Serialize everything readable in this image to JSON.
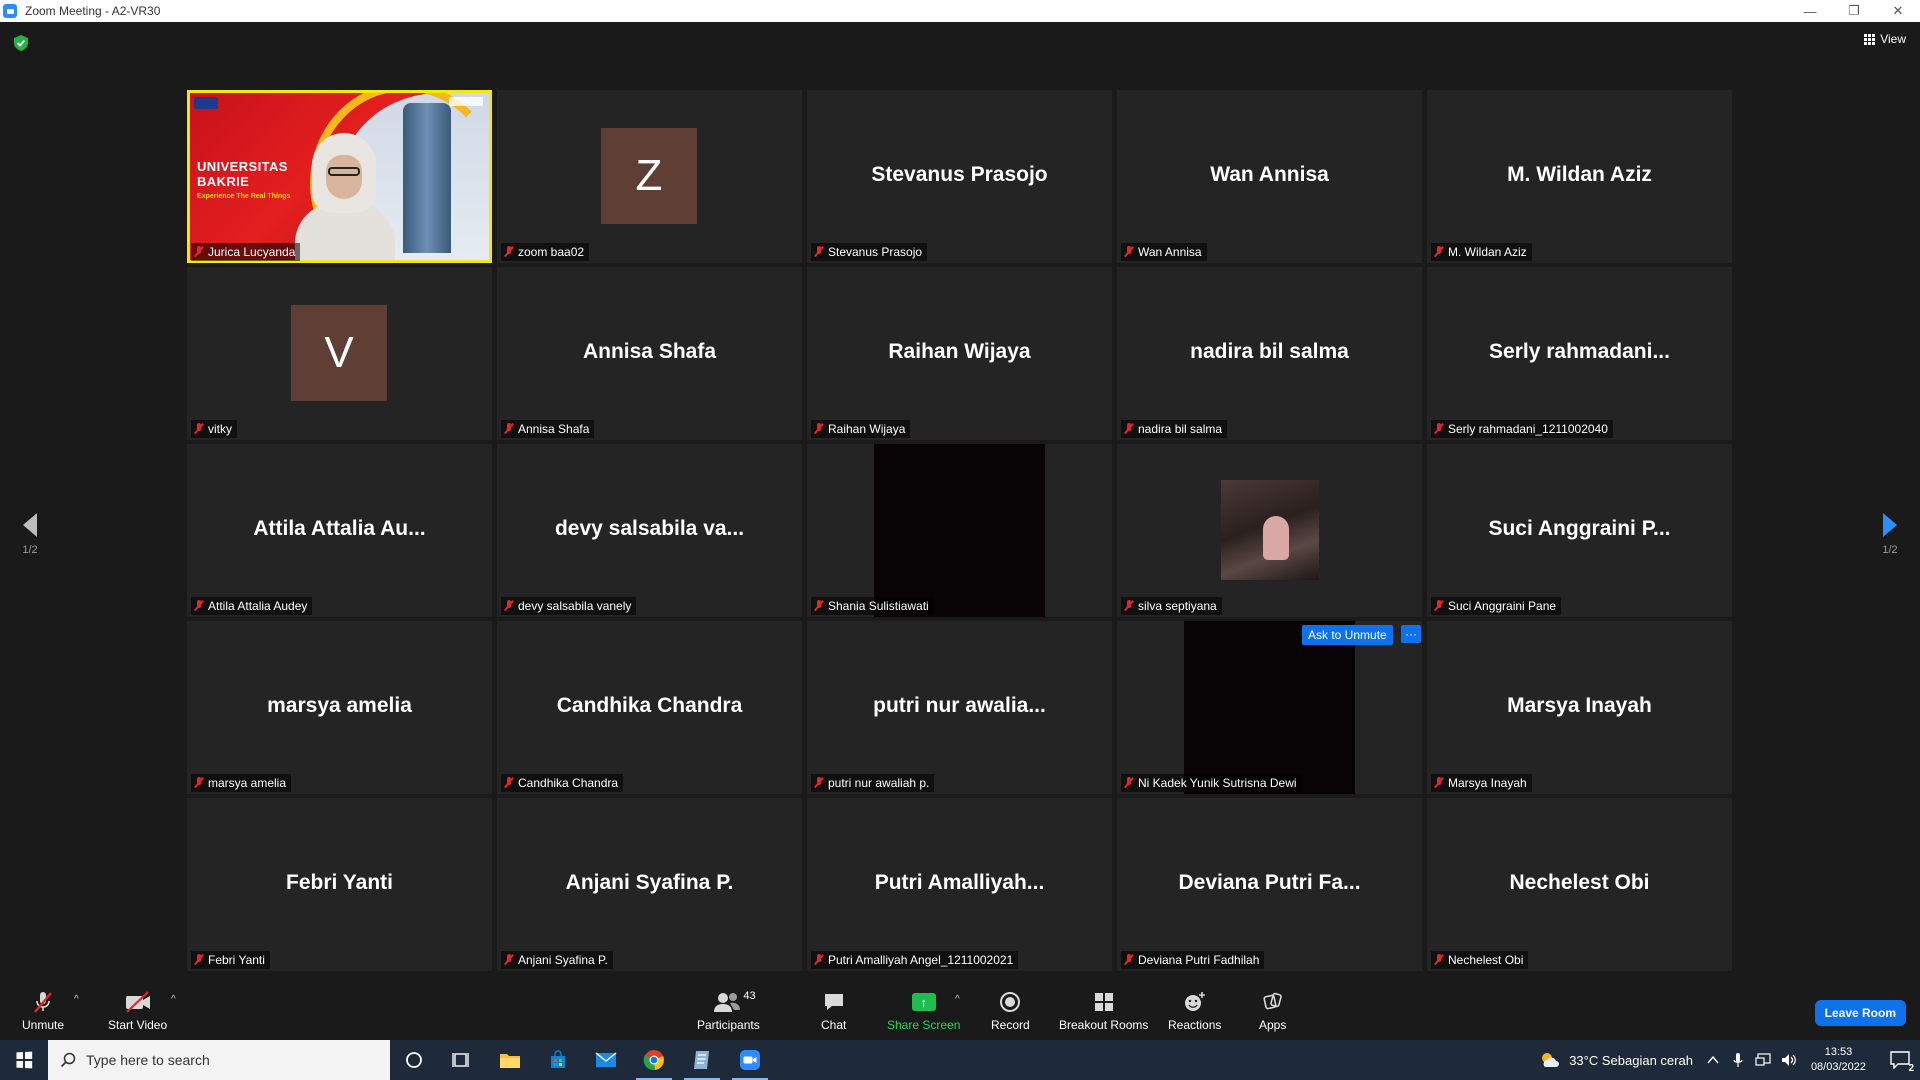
{
  "window": {
    "title": "Zoom Meeting - A2-VR30",
    "minimize": "—",
    "restore": "❐",
    "close": "✕"
  },
  "top": {
    "view_label": "View"
  },
  "pager": {
    "left_label": "1/2",
    "right_label": "1/2"
  },
  "tiles": [
    {
      "kind": "speaker",
      "name": "Jurica Lucyanda",
      "video_text": "UNIVERSITAS BAKRIE",
      "video_tagline": "Experience The Real Things"
    },
    {
      "kind": "avatar",
      "avatar_letter": "Z",
      "name": "zoom baa02"
    },
    {
      "kind": "text",
      "display": "Stevanus Prasojo",
      "name": "Stevanus Prasojo"
    },
    {
      "kind": "text",
      "display": "Wan Annisa",
      "name": "Wan Annisa"
    },
    {
      "kind": "text",
      "display": "M. Wildan Aziz",
      "name": "M. Wildan Aziz"
    },
    {
      "kind": "avatar",
      "avatar_letter": "V",
      "name": "vitky"
    },
    {
      "kind": "text",
      "display": "Annisa Shafa",
      "name": "Annisa Shafa"
    },
    {
      "kind": "text",
      "display": "Raihan Wijaya",
      "name": "Raihan Wijaya"
    },
    {
      "kind": "text",
      "display": "nadira bil salma",
      "name": "nadira bil salma"
    },
    {
      "kind": "text",
      "display": "Serly  rahmadani...",
      "name": "Serly rahmadani_1211002040"
    },
    {
      "kind": "text",
      "display": "Attila Attalia Au...",
      "name": "Attila Attalia Audey"
    },
    {
      "kind": "text",
      "display": "devy salsabila va...",
      "name": "devy salsabila vanely"
    },
    {
      "kind": "dark",
      "name": "Shania Sulistiawati"
    },
    {
      "kind": "camera",
      "name": "silva septiyana"
    },
    {
      "kind": "text",
      "display": "Suci Anggraini P...",
      "name": "Suci Anggraini Pane"
    },
    {
      "kind": "text",
      "display": "marsya amelia",
      "name": "marsya amelia"
    },
    {
      "kind": "text",
      "display": "Candhika Chandra",
      "name": "Candhika Chandra"
    },
    {
      "kind": "text",
      "display": "putri nur awalia...",
      "name": "putri nur awaliah p."
    },
    {
      "kind": "dark",
      "name": "Ni Kadek Yunik Sutrisna Dewi",
      "ask_unmute": "Ask to Unmute",
      "more": "···"
    },
    {
      "kind": "text",
      "display": "Marsya Inayah",
      "name": "Marsya Inayah"
    },
    {
      "kind": "text",
      "display": "Febri Yanti",
      "name": "Febri Yanti"
    },
    {
      "kind": "text",
      "display": "Anjani Syafina P.",
      "name": "Anjani Syafina P."
    },
    {
      "kind": "text",
      "display": "Putri  Amalliyah...",
      "name": "Putri Amalliyah Angel_1211002021"
    },
    {
      "kind": "text",
      "display": "Deviana Putri Fa...",
      "name": "Deviana Putri Fadhilah"
    },
    {
      "kind": "text",
      "display": "Nechelest Obi",
      "name": "Nechelest Obi"
    }
  ],
  "toolbar": {
    "unmute": "Unmute",
    "start_video": "Start Video",
    "participants": "Participants",
    "participants_count": "43",
    "chat": "Chat",
    "share_screen": "Share Screen",
    "record": "Record",
    "breakout_rooms": "Breakout Rooms",
    "reactions": "Reactions",
    "apps": "Apps",
    "leave": "Leave Room"
  },
  "taskbar": {
    "search_placeholder": "Type here to search",
    "weather": "33°C  Sebagian cerah",
    "time": "13:53",
    "date": "08/03/2022",
    "notification_count": "2"
  },
  "colors": {
    "speaker_border": "#f5e90a",
    "accent_blue": "#0e72ed",
    "share_green": "#23d959",
    "mute_red": "#e02828"
  }
}
